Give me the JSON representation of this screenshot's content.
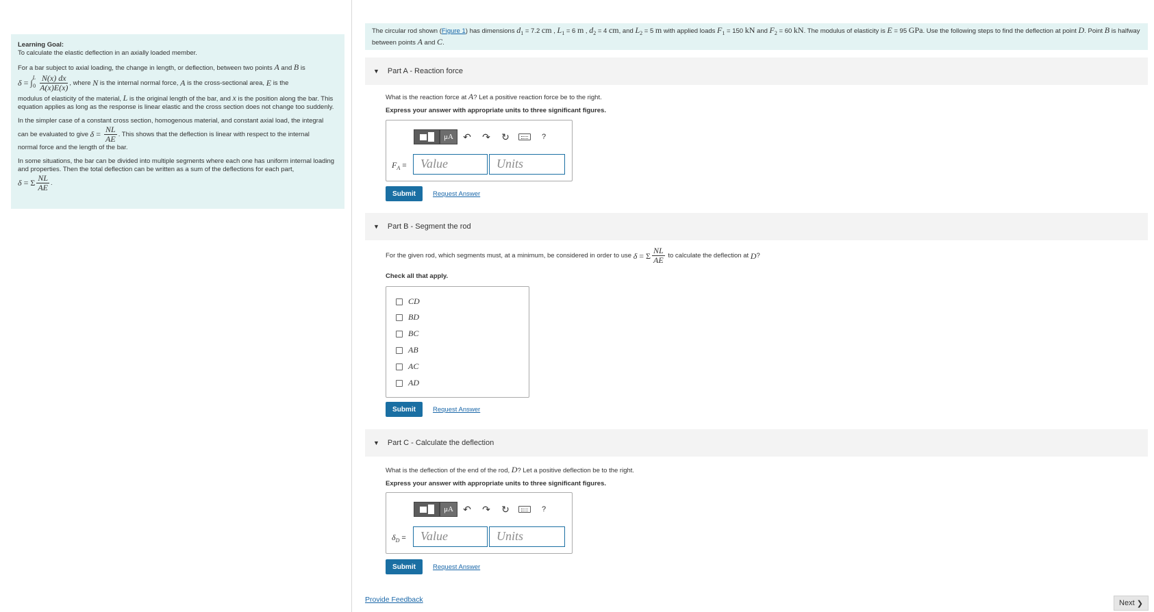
{
  "learning_goal": {
    "title": "Learning Goal:",
    "subtitle": "To calculate the elastic deflection in an axially loaded member.",
    "p1_a": "For a bar subject to axial loading, the change in length, or deflection, between two points",
    "p1_and": "and",
    "p1_is": "is",
    "p1_where": ", where",
    "p1_internal": "is the internal normal force,",
    "p1_cross": "is the cross-sectional area,",
    "p1_is2": "is the",
    "p1_modulus": "modulus of elasticity of the material,",
    "p1_original": "is the original length of the bar, and",
    "p1_position": "is the position along the bar.",
    "p1_applies": "This equation applies as long as the response is linear elastic and the cross section does not change too suddenly.",
    "p2_a": "In the simpler case of a constant cross section, homogenous material, and constant axial load, the integral",
    "p2_b": "can be evaluated to give",
    "p2_c": ". This shows that the deflection is linear with respect to the internal",
    "p2_d": "normal force and the length of the bar.",
    "p3": "In some situations, the bar can be divided into multiple segments where each one has uniform internal loading and properties. Then the total deflection can be written as a sum of the deflections for each part,"
  },
  "problem": {
    "pre": "The circular rod shown (",
    "figure_link": "Figure 1",
    "post": ") has dimensions",
    "d1": "= 7.2",
    "l1": "= 6",
    "d2": "= 4",
    "and": ", and",
    "l2": "= 5",
    "loads": "with applied loads",
    "f1": "= 150",
    "and2": "and",
    "f2": "= 60",
    "modulus": ". The modulus of elasticity is",
    "e": "= 95",
    "steps": ". Use the following steps to find the deflection at point",
    "point": ". Point",
    "halfway": "is halfway between points",
    "and3": "and",
    "unit_cm": "cm",
    "unit_m": "m",
    "unit_kn": "kN",
    "unit_gpa": "GPa"
  },
  "part_a": {
    "title": "Part A - Reaction force",
    "question_pre": "What is the reaction force at",
    "question_post": "? Let a positive reaction force be to the right.",
    "instruction": "Express your answer with appropriate units to three significant figures.",
    "var_label": "F",
    "var_sub": "A",
    "value_placeholder": "Value",
    "units_placeholder": "Units"
  },
  "part_b": {
    "title": "Part B - Segment the rod",
    "question_pre": "For the given rod, which segments must, at a minimum, be considered in order to use",
    "question_post": "to calculate the deflection at",
    "instruction": "Check all that apply.",
    "options": [
      "CD",
      "BD",
      "BC",
      "AB",
      "AC",
      "AD"
    ]
  },
  "part_c": {
    "title": "Part C - Calculate the deflection",
    "question_pre": "What is the deflection of the end of the rod,",
    "question_post": "? Let a positive deflection be to the right.",
    "instruction": "Express your answer with appropriate units to three significant figures.",
    "var_label": "δ",
    "var_sub": "D",
    "value_placeholder": "Value",
    "units_placeholder": "Units"
  },
  "toolbar": {
    "mu": "μA",
    "help": "?"
  },
  "buttons": {
    "submit": "Submit",
    "request_answer": "Request Answer"
  },
  "footer": {
    "feedback": "Provide Feedback",
    "next": "Next"
  }
}
